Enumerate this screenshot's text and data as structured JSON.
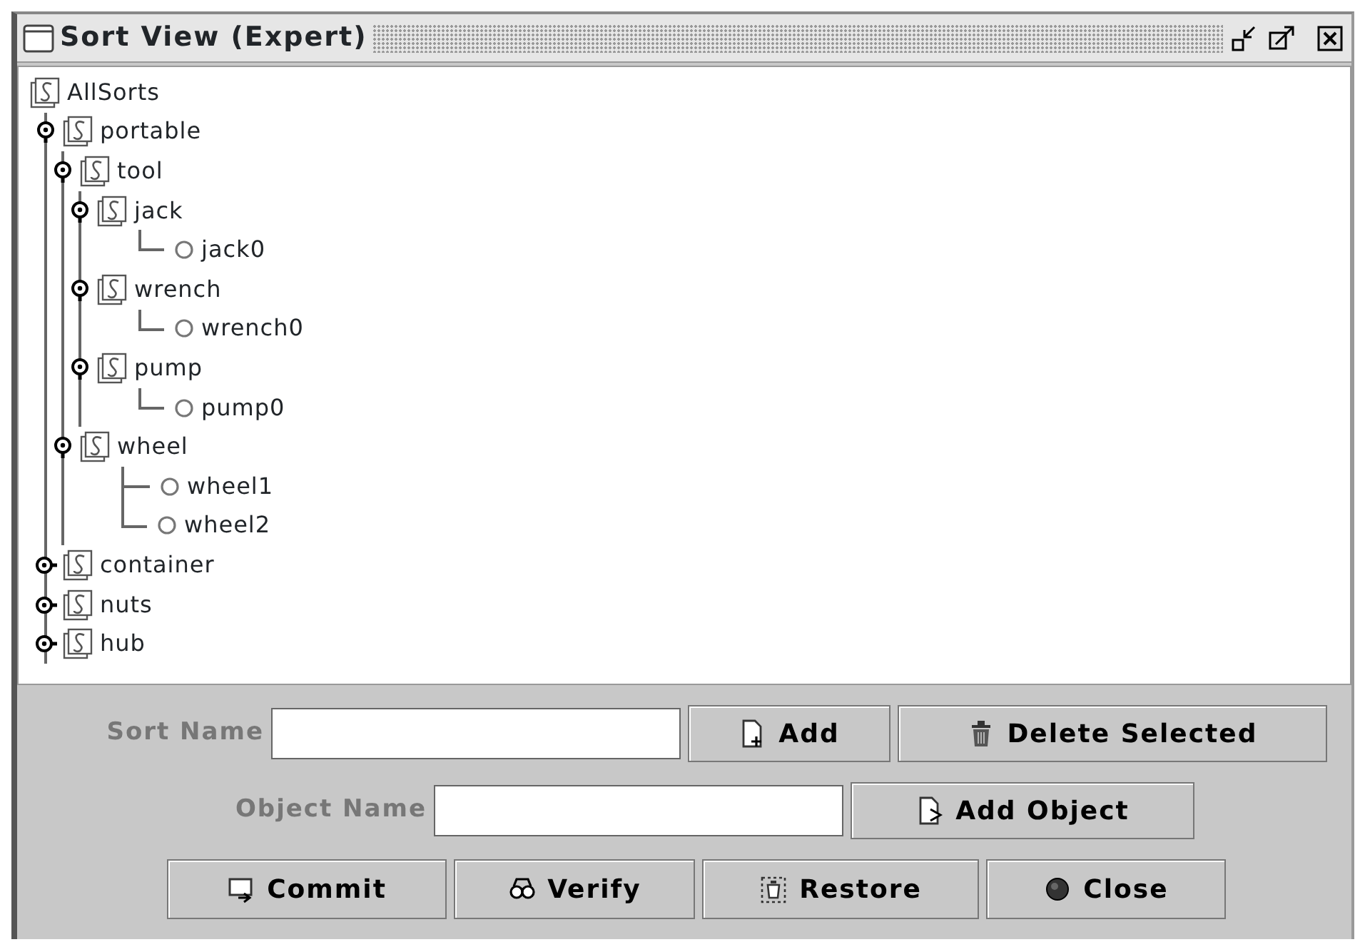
{
  "window": {
    "title": "Sort View (Expert)"
  },
  "tree": {
    "label": "AllSorts",
    "kind": "sort",
    "children": [
      {
        "label": "portable",
        "kind": "sort",
        "expanded": true,
        "children": [
          {
            "label": "tool",
            "kind": "sort",
            "expanded": true,
            "children": [
              {
                "label": "jack",
                "kind": "sort",
                "expanded": true,
                "children": [
                  {
                    "label": "jack0",
                    "kind": "object"
                  }
                ]
              },
              {
                "label": "wrench",
                "kind": "sort",
                "expanded": true,
                "children": [
                  {
                    "label": "wrench0",
                    "kind": "object"
                  }
                ]
              },
              {
                "label": "pump",
                "kind": "sort",
                "expanded": true,
                "children": [
                  {
                    "label": "pump0",
                    "kind": "object"
                  }
                ]
              }
            ]
          },
          {
            "label": "wheel",
            "kind": "sort",
            "expanded": true,
            "children": [
              {
                "label": "wheel1",
                "kind": "object"
              },
              {
                "label": "wheel2",
                "kind": "object"
              }
            ]
          }
        ]
      },
      {
        "label": "container",
        "kind": "sort",
        "expanded": false
      },
      {
        "label": "nuts",
        "kind": "sort",
        "expanded": false
      },
      {
        "label": "hub",
        "kind": "sort",
        "expanded": false
      }
    ]
  },
  "sort_row": {
    "label": "Sort Name",
    "buttons": [
      {
        "label": "Add"
      },
      {
        "label": "Delete Selected"
      }
    ]
  },
  "object_row": {
    "label": "Object Name",
    "buttons": [
      {
        "label": "Add Object"
      }
    ]
  },
  "actions": [
    {
      "label": "Commit"
    },
    {
      "label": "Verify"
    },
    {
      "label": "Restore"
    },
    {
      "label": "Close"
    }
  ]
}
